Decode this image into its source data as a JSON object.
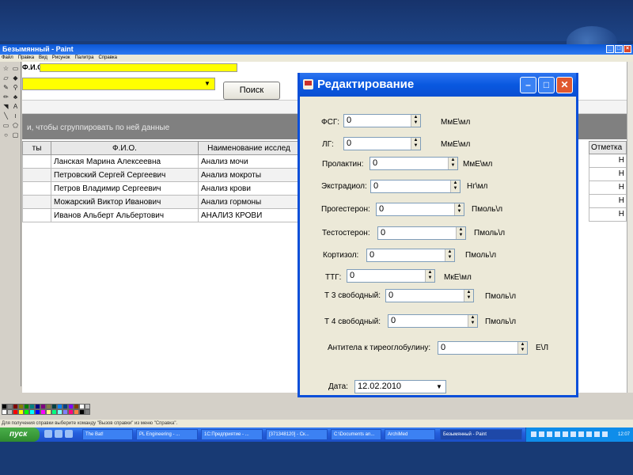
{
  "paint": {
    "title": "Безымянный - Paint",
    "menu": [
      "Файл",
      "Правка",
      "Вид",
      "Рисунок",
      "Палитра",
      "Справка"
    ],
    "status": "Для получения справки выберите команду \"Вызов справки\" из меню \"Справка\"."
  },
  "app": {
    "fio_label": "Ф.И.О.",
    "search_label": "Поиск",
    "group_hint": "и, чтобы сгруппировать по ней данные",
    "columns": [
      "ты",
      "Ф.И.О.",
      "Наименование исслед"
    ],
    "right_column_header": "Отметка",
    "rows": [
      {
        "fio": "Ланская Марина Алексеевна",
        "name": "Анализ мочи",
        "mark": "Н"
      },
      {
        "fio": "Петровский Сергей Сергеевич",
        "name": "Анализ мокроты",
        "mark": "Н"
      },
      {
        "fio": "Петров Владимир Сергеевич",
        "name": "Анализ крови",
        "mark": "Н"
      },
      {
        "fio": "Можарский Виктор Иванович",
        "name": "Анализ гормоны",
        "mark": "Н"
      },
      {
        "fio": "Иванов Альберт Альбертович",
        "name": "АНАЛИЗ КРОВИ",
        "mark": "Н"
      }
    ]
  },
  "dialog": {
    "title": "Редактирование",
    "fields": [
      {
        "label": "ФСГ:",
        "value": "0",
        "unit": "МмЕ\\мл"
      },
      {
        "label": "ЛГ:",
        "value": "0",
        "unit": "МмЕ\\мл"
      },
      {
        "label": "Пролактин:",
        "value": "0",
        "unit": "МмЕ\\мл"
      },
      {
        "label": "Экстрадиол:",
        "value": "0",
        "unit": "Нг\\мл"
      },
      {
        "label": "Прогестерон:",
        "value": "0",
        "unit": "Пмоль\\л"
      },
      {
        "label": "Тестостерон:",
        "value": "0",
        "unit": "Пмоль\\л"
      },
      {
        "label": "Кортизол:",
        "value": "0",
        "unit": "Пмоль\\л"
      },
      {
        "label": "ТТГ:",
        "value": "0",
        "unit": "МкЕ\\мл"
      },
      {
        "label": "Т 3 свободный:",
        "value": "0",
        "unit": "Пмоль\\л"
      },
      {
        "label": "Т 4 свободный:",
        "value": "0",
        "unit": "Пмоль\\л"
      },
      {
        "label": "Антитела к тиреоглобулину:",
        "value": "0",
        "unit": "Е\\Л"
      }
    ],
    "date_label": "Дата:",
    "date_value": "12.02.2010"
  },
  "taskbar": {
    "start": "пуск",
    "tasks": [
      "The Bat!",
      "PL Engineering - ...",
      "1С:Предприятие - ...",
      "[371348120] - Ск...",
      "C:\\Documents an...",
      "ArchiMed",
      "Безымянный - Paint"
    ],
    "clock": "12:07"
  },
  "colors": {
    "accent": "#0a57d6",
    "highlight": "#ffff00",
    "taskbar": "#245edc",
    "start": "#2f8a2f"
  }
}
